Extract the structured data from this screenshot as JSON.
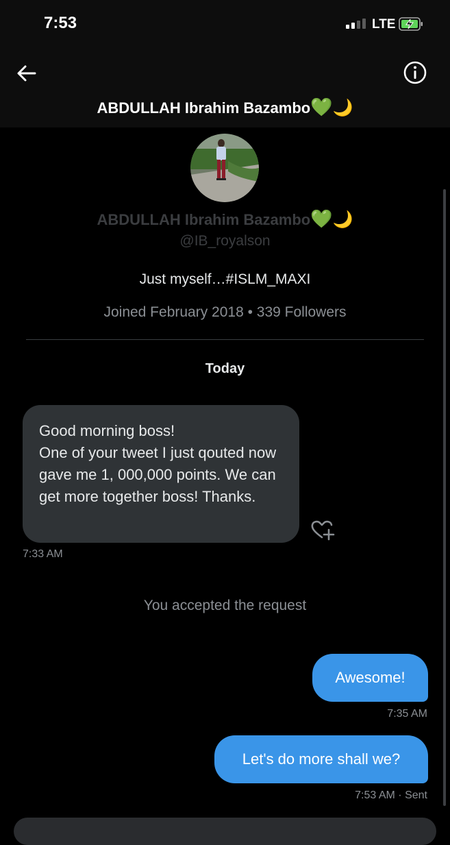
{
  "status_bar": {
    "time": "7:53",
    "network": "LTE",
    "signal_bars": 4,
    "signal_bars_active": 2,
    "battery_state": "charging"
  },
  "header": {
    "title": "ABDULLAH Ibrahim Bazambo",
    "title_emoji_1": "💚",
    "title_emoji_2": "🌙",
    "back_icon": "back-arrow-icon",
    "info_icon": "info-icon"
  },
  "profile": {
    "name": "ABDULLAH Ibrahim Bazambo",
    "name_emoji_1": "💚",
    "name_emoji_2": "🌙",
    "handle": "@IB_royalson",
    "bio": "Just myself…#ISLM_MAXI",
    "joined": "Joined February 2018 • 339 Followers"
  },
  "conversation": {
    "day_label": "Today",
    "incoming": {
      "text": "Good morning boss!\nOne of your tweet I just qouted now gave me 1, 000,000 points. We can get more together boss! Thanks.",
      "time": "7:33 AM",
      "react_icon": "heart-plus-icon"
    },
    "system_message": "You accepted the request",
    "outgoing": [
      {
        "text": "Awesome!",
        "time": "7:35 AM"
      },
      {
        "text": "Let's do more shall we?",
        "time": "7:53 AM · Sent"
      }
    ]
  },
  "colors": {
    "background": "#000000",
    "incoming_bubble": "#2f3336",
    "outgoing_bubble": "#3a95e8",
    "secondary_text": "#8b8f94"
  }
}
